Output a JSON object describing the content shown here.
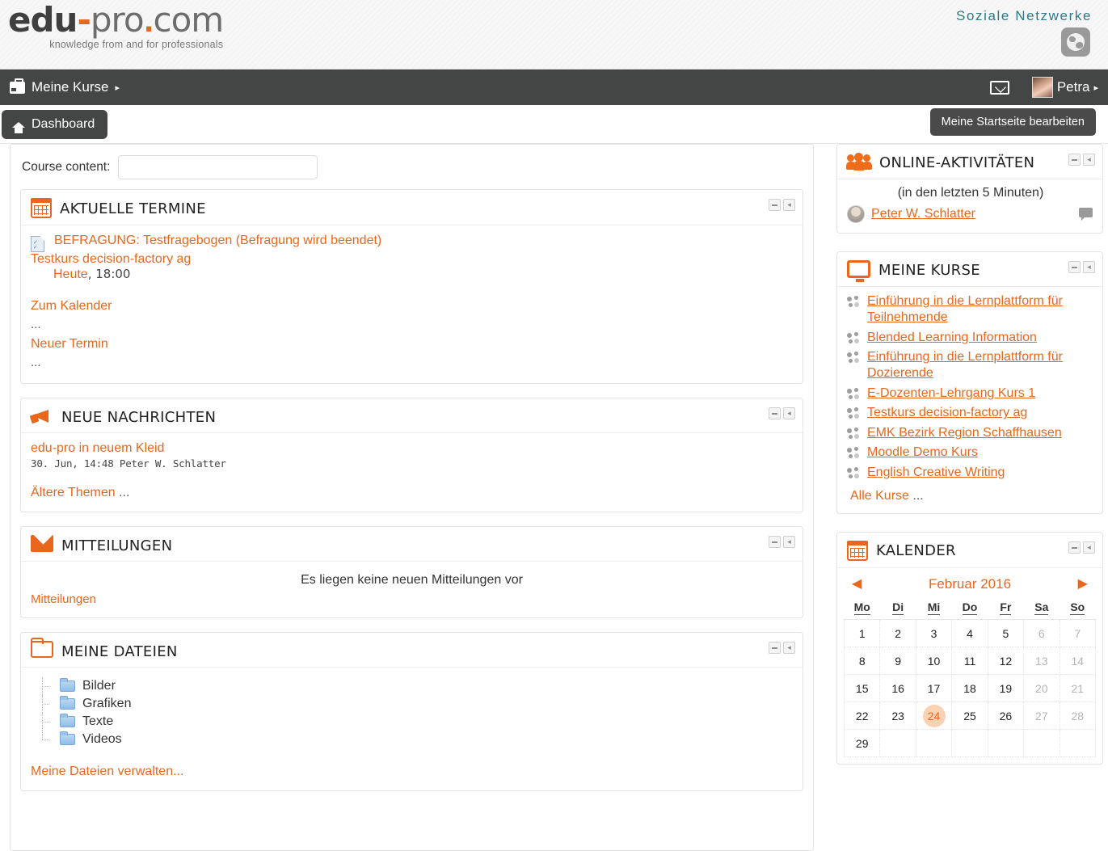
{
  "header": {
    "logo": {
      "edu": "edu",
      "dash": "-",
      "pro": "pro",
      "square": ".",
      "com": "com",
      "tagline": "knowledge from and for professionals"
    },
    "social_label": "Soziale Netzwerke",
    "social_icon": "globe-icon"
  },
  "navbar": {
    "my_courses": "Meine Kurse",
    "caret": "▸",
    "messages_icon": "envelope-icon",
    "user_name": "Petra",
    "user_caret": "▸"
  },
  "tabs": {
    "dashboard": "Dashboard",
    "edit_homepage": "Meine Startseite bearbeiten"
  },
  "main": {
    "course_content_label": "Course content:",
    "course_content_value": "",
    "course_content_placeholder": "",
    "blocks": {
      "events": {
        "title": "AKTUELLE TERMINE",
        "icon": "calendar-icon",
        "event_link": "BEFRAGUNG: Testfragebogen (Befragung wird beendet)",
        "event_course": "Testkurs decision-factory ag",
        "event_day": "Heute",
        "event_time": ", 18:00",
        "link_calendar": "Zum Kalender",
        "link_new_event": "Neuer Termin",
        "ellipsis": "..."
      },
      "news": {
        "title": "NEUE NACHRICHTEN",
        "icon": "megaphone-icon",
        "item_title": "edu-pro in neuem Kleid",
        "item_meta": "30. Jun, 14:48 Peter W. Schlatter",
        "older": "Ältere Themen",
        "ellipsis": "..."
      },
      "messages": {
        "title": "MITTEILUNGEN",
        "icon": "envelope-icon",
        "empty_text": "Es liegen keine neuen Mitteilungen vor",
        "link": "Mitteilungen"
      },
      "files": {
        "title": "MEINE DATEIEN",
        "icon": "folder-icon",
        "items": [
          "Bilder",
          "Grafiken",
          "Texte",
          "Videos"
        ],
        "manage_link": "Meine Dateien verwalten..."
      }
    }
  },
  "sidebar": {
    "online": {
      "title": "ONLINE-AKTIVITÄTEN",
      "icon": "people-icon",
      "note": "(in den letzten 5 Minuten)",
      "user": "Peter W. Schlatter",
      "chat_icon": "chat-bubble-icon"
    },
    "courses": {
      "title": "MEINE KURSE",
      "icon": "monitor-icon",
      "items": [
        "Einführung in die Lernplattform für Teilnehmende",
        "Blended Learning Information",
        "Einführung in die Lernplattform für Dozierende",
        "E-Dozenten-Lehrgang Kurs 1",
        "Testkurs decision-factory ag",
        "EMK Bezirk Region Schaffhausen",
        "Moodle Demo Kurs",
        "English Creative Writing"
      ],
      "all_courses": "Alle Kurse",
      "ellipsis": "..."
    },
    "calendar": {
      "title": "KALENDER",
      "icon": "calendar-icon",
      "prev": "◀",
      "next": "▶",
      "month": "Februar 2016",
      "daynames": [
        "Mo",
        "Di",
        "Mi",
        "Do",
        "Fr",
        "Sa",
        "So"
      ],
      "weeks": [
        [
          "1",
          "2",
          "3",
          "4",
          "5",
          "6",
          "7"
        ],
        [
          "8",
          "9",
          "10",
          "11",
          "12",
          "13",
          "14"
        ],
        [
          "15",
          "16",
          "17",
          "18",
          "19",
          "20",
          "21"
        ],
        [
          "22",
          "23",
          "24",
          "25",
          "26",
          "27",
          "28"
        ],
        [
          "29",
          "",
          "",
          "",
          "",
          "",
          ""
        ]
      ],
      "today": "24"
    }
  },
  "block_controls": {
    "collapse": "–",
    "dock": "◂"
  },
  "colors": {
    "accent": "#e8671c",
    "navbar": "#444545",
    "teal": "#2e7a86"
  }
}
